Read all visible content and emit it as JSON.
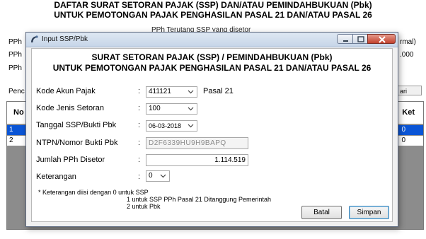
{
  "background": {
    "title_line1": "DAFTAR SURAT SETORAN PAJAK (SSP) DAN/ATAU PEMINDAHBUKUAN (Pbk)",
    "title_line2": "UNTUK PEMOTONGAN PAJAK PENGHASILAN PASAL 21 DAN/ATAU PASAL 26",
    "subheader": "PPh Terutang    SSP yang disetor",
    "left_labels": [
      "PPh",
      "PPh",
      "PPh",
      "Penc"
    ],
    "right_labels": [
      "rmal)",
      ".000"
    ],
    "btn_partial": "ari",
    "table": {
      "header_no": "No",
      "header_ket": "Ket",
      "rows": [
        {
          "num": "1",
          "ket": "0"
        },
        {
          "num": "2",
          "ket": "0"
        }
      ]
    }
  },
  "dialog": {
    "window_title": "Input SSP/Pbk",
    "header_line1": "SURAT SETORAN PAJAK (SSP) / PEMINDAHBUKUAN (Pbk)",
    "header_line2": "UNTUK PEMOTONGAN PAJAK PENGHASILAN PASAL 21 DAN/ATAU PASAL 26",
    "colon": ":",
    "fields": {
      "kode_akun": {
        "label": "Kode Akun Pajak",
        "value": "411121",
        "desc": "Pasal 21"
      },
      "kode_jenis": {
        "label": "Kode Jenis Setoran",
        "value": "100"
      },
      "tanggal": {
        "label": "Tanggal SSP/Bukti Pbk",
        "value": "06-03-2018"
      },
      "ntpn": {
        "label": "NTPN/Nomor Bukti Pbk",
        "value": "D2F6339HU9H9BAPQ"
      },
      "jumlah": {
        "label": "Jumlah PPh Disetor",
        "value": "1.114.519"
      },
      "keterangan": {
        "label": "Keterangan",
        "value": "0"
      }
    },
    "note": {
      "line1": "* Keterangan diisi dengan  0 untuk SSP",
      "line2": "1 untuk SSP PPh Pasal 21 Ditanggung Pemerintah",
      "line3": "2 untuk Pbk"
    },
    "buttons": {
      "batal": "Batal",
      "simpan": "Simpan"
    }
  },
  "icons": {
    "app": "app-icon",
    "minimize": "minimize-icon",
    "maximize": "maximize-icon",
    "close": "close-icon",
    "dropdown": "chevron-down-icon"
  },
  "colors": {
    "selection": "#0a55d6",
    "close": "#c3412d"
  }
}
